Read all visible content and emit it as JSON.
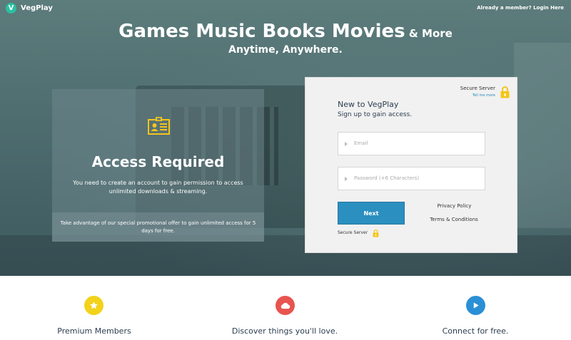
{
  "brand": {
    "name": "VegPlay",
    "logo_letter": "V"
  },
  "header": {
    "login_link": "Already a member? Login Here"
  },
  "hero": {
    "headline_big": "Games Music Books Movies",
    "headline_small": "& More",
    "subline": "Anytime, Anywhere."
  },
  "access": {
    "title": "Access Required",
    "description": "You need to create an account to gain permission to access unlimited downloads & streaming.",
    "promo": "Take advantage of our special promotional offer to gain unlimited access for 5 days for free."
  },
  "signup": {
    "secure_label": "Secure Server",
    "tell_me_more": "Tell me more",
    "title": "New to VegPlay",
    "subtitle": "Sign up to gain access.",
    "email_placeholder": "Email",
    "password_placeholder": "Password (+6 Characters)",
    "next_button": "Next",
    "privacy_link": "Privacy Policy",
    "terms_link": "Terms & Conditions",
    "secure_bottom": "Secure Server"
  },
  "features": [
    {
      "label": "Premium Members",
      "icon": "star-icon",
      "color": "#f2d21a"
    },
    {
      "label": "Discover things you'll love.",
      "icon": "cloud-icon",
      "color": "#e8544f"
    },
    {
      "label": "Connect for free.",
      "icon": "play-icon",
      "color": "#2b8fd6"
    }
  ],
  "colors": {
    "accent": "#2b8fbf",
    "lock": "#f5c518",
    "logo": "#2bbfa3"
  }
}
